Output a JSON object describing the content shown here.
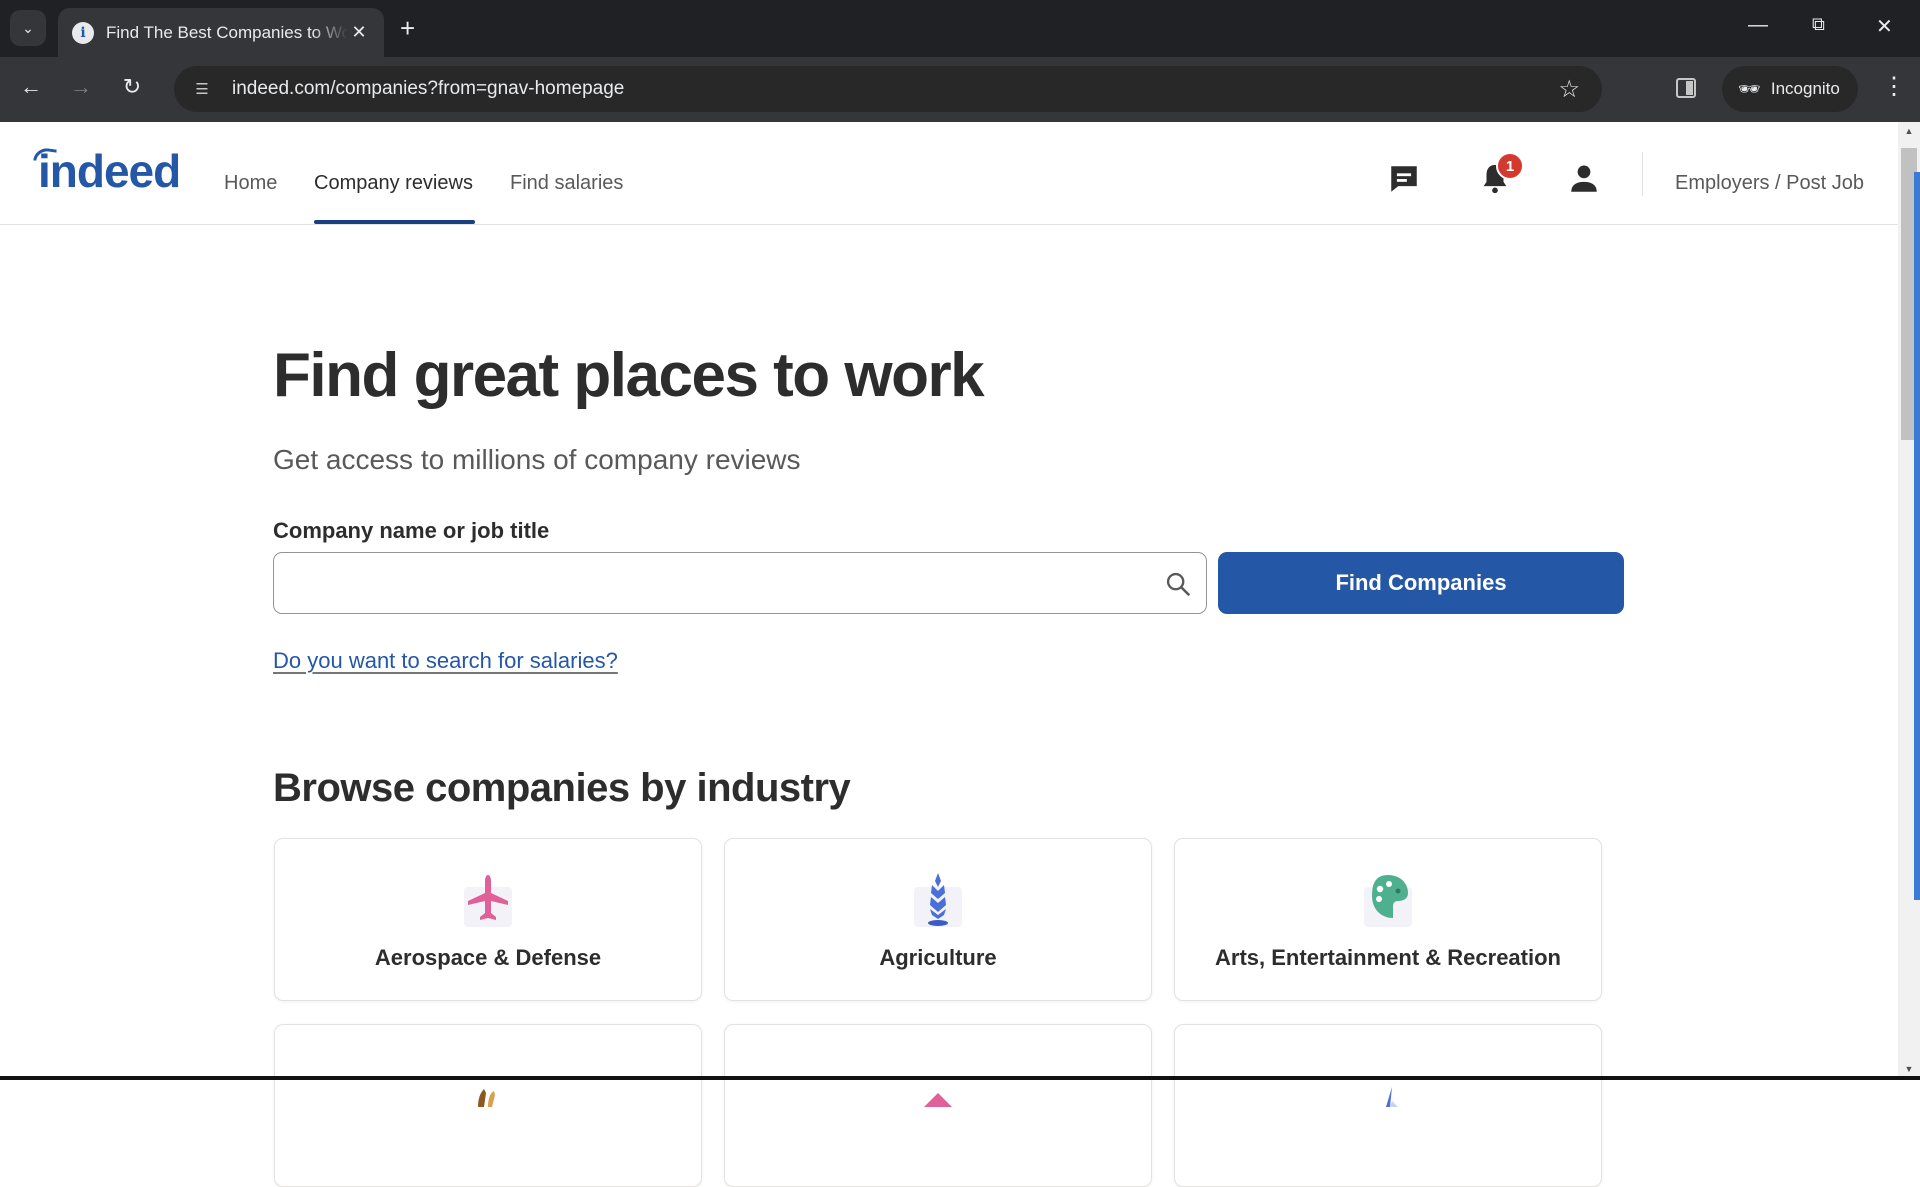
{
  "browser": {
    "tab_title": "Find The Best Companies to Work For",
    "url": "indeed.com/companies?from=gnav-homepage",
    "incognito_label": "Incognito",
    "icons": {
      "tab_list": "chevron-down-icon",
      "favicon": "indeed-favicon",
      "tab_close": "close-icon",
      "new_tab": "plus-icon",
      "back": "arrow-left-icon",
      "forward": "arrow-right-icon",
      "reload": "reload-icon",
      "site_info": "tune-icon",
      "bookmark": "star-icon",
      "side_panel": "side-panel-icon",
      "incognito": "incognito-icon",
      "menu": "kebab-icon",
      "minimize": "minimize-icon",
      "restore": "restore-icon",
      "close_window": "close-icon"
    }
  },
  "header": {
    "logo": "indeed",
    "nav": [
      {
        "label": "Home",
        "active": false
      },
      {
        "label": "Company reviews",
        "active": true
      },
      {
        "label": "Find salaries",
        "active": false
      }
    ],
    "notification_count": "1",
    "employers_label": "Employers / Post Job"
  },
  "hero": {
    "title": "Find great places to work",
    "subtitle": "Get access to millions of company reviews",
    "field_label": "Company name or job title",
    "search_value": "",
    "search_placeholder": "",
    "button_label": "Find Companies",
    "salary_link": "Do you want to search for salaries?"
  },
  "industries": {
    "title": "Browse companies by industry",
    "items": [
      {
        "label": "Aerospace & Defense",
        "icon": "airplane-icon",
        "color": "#e0609a"
      },
      {
        "label": "Agriculture",
        "icon": "wheat-icon",
        "color": "#4a6fd8"
      },
      {
        "label": "Arts, Entertainment & Recreation",
        "icon": "palette-icon",
        "color": "#4fb090"
      },
      {
        "label": "",
        "icon": "hands-icon",
        "color": "#b07a3a"
      },
      {
        "label": "",
        "icon": "diamond-icon",
        "color": "#e0609a"
      },
      {
        "label": "",
        "icon": "pen-icon",
        "color": "#4a6fd8"
      }
    ]
  },
  "colors": {
    "brand": "#2557a7",
    "text_primary": "#2d2d2d",
    "text_secondary": "#595959",
    "badge": "#d4392e"
  }
}
